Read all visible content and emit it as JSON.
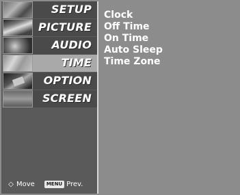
{
  "menu": {
    "items": [
      {
        "label": "SETUP",
        "icon": "setup-thumbnail-icon",
        "active": false
      },
      {
        "label": "PICTURE",
        "icon": "picture-thumbnail-icon",
        "active": false
      },
      {
        "label": "AUDIO",
        "icon": "audio-thumbnail-icon",
        "active": false
      },
      {
        "label": "TIME",
        "icon": "time-thumbnail-icon",
        "active": true
      },
      {
        "label": "OPTION",
        "icon": "option-thumbnail-icon",
        "active": false
      },
      {
        "label": "SCREEN",
        "icon": "screen-thumbnail-icon",
        "active": false
      }
    ]
  },
  "submenu": {
    "items": [
      "Clock",
      "Off Time",
      "On Time",
      "Auto Sleep",
      "Time Zone"
    ]
  },
  "footer": {
    "move_icon": "◇",
    "move_label": "Move",
    "menu_key": "MENU",
    "prev_label": "Prev."
  },
  "colors": {
    "panel": "#8c8c8c",
    "sidebar": "#5a5a5a",
    "active_item": "#a9a9a9",
    "text": "#ffffff"
  }
}
